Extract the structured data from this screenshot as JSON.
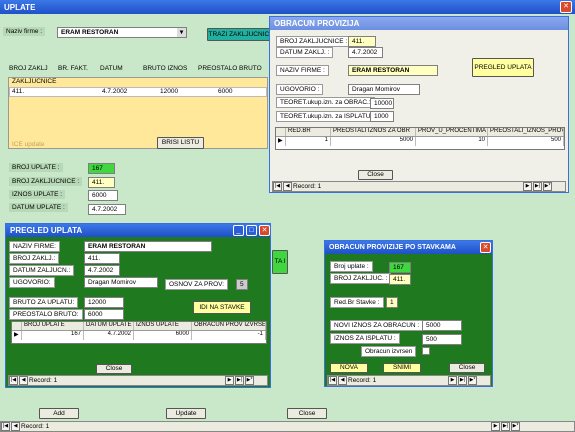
{
  "main": {
    "title": "UPLATE",
    "naziv_firme_label": "Naziv firme :",
    "naziv_firme_value": "ERAM RESTORAN",
    "trazi_btn": "TRAZI ZAKLJUCNICE",
    "columns": [
      "BROJ ZAKLJ",
      "BR. FAKT.",
      "DATUM",
      "BRUTO IZNOS",
      "PREOSTALO BRUTO"
    ],
    "zakljucnice_label": "ZAKLJUCNICE",
    "row": {
      "broj": "411.",
      "datum": "4.7.2002",
      "bruto": "12000",
      "preostalo": "6000"
    },
    "ice_label": "ICE update",
    "brisi_btn": "BRISI LISTU",
    "broj_uplate_label": "BROJ UPLATE :",
    "broj_uplate_value": "167",
    "broj_zakljucnice_label": "BROJ ZAKLJUCNICE :",
    "broj_zakljucnice_value": "411.",
    "iznos_uplate_label": "IZNOS UPLATE :",
    "iznos_uplate_value": "6000",
    "datum_uplate_label": "DATUM UPLATE :",
    "datum_uplate_value": "4.7.2002",
    "add_btn": "Add",
    "update_btn": "Update",
    "close_btn": "Close",
    "record": "Record: 1",
    "green_btn": "TA I"
  },
  "obracun": {
    "title": "OBRACUN PROVIZIJA",
    "broj_zakl_label": "BROJ ZAKLJUCNICE :",
    "broj_zakl_value": "411.",
    "datum_label": "DATUM ZAKLJ. :",
    "datum_value": "4.7.2002",
    "naziv_label": "NAZIV FIRME :",
    "naziv_value": "ERAM RESTORAN",
    "pregled_btn": "PREGLED UPLATA",
    "ugovorio_label": "UGOVORIO :",
    "ugovorio_value": "Dragan Momirov",
    "teor_obrac_label": "TEORET.ukup.izn. za OBRAC.:",
    "teor_obrac_value": "10000",
    "teor_isplatu_label": "TEORET.ukup.izn. za ISPLATU :",
    "teor_isplatu_value": "1000",
    "columns": [
      "RED.BR",
      "PREOSTALI IZNOS ZA OBR",
      "PROV_U_PROCENTIMA",
      "PREOSTALI_IZNOS_PROV"
    ],
    "row": [
      "1",
      "5000",
      "10",
      "500"
    ],
    "close_btn": "Close",
    "record": "Record: 1"
  },
  "pregled": {
    "title": "PREGLED UPLATA",
    "naziv_label": "NAZIV FIRME:",
    "naziv_value": "ERAM RESTORAN",
    "broj_zakl_label": "BROJ ZAKLJ.:",
    "broj_zakl_value": "411.",
    "datum_label": "DATUM ZALJUCN.:",
    "datum_value": "4.7.2002",
    "ugovorio_label": "UGOVORIO:",
    "ugovorio_value": "Dragan Momirov",
    "osnov_label": "OSNOV ZA PROV:",
    "osnov_value": "5",
    "bruto_label": "BRUTO ZA UPLATU:",
    "bruto_value": "12000",
    "preostalo_label": "PREOSTALO BRUTO:",
    "preostalo_value": "6000",
    "idi_btn": "IDI NA STAVKE",
    "columns": [
      "BROJ UPLATE",
      "DATUM UPLATE",
      "IZNOS UPLATE",
      "OBRACUN PROV IZVRSEN"
    ],
    "row": [
      "167",
      "4.7.2002",
      "6000",
      "-1"
    ],
    "close_btn": "Close",
    "record": "Record: 1"
  },
  "stavke": {
    "title": "OBRACUN PROVIZIJE PO STAVKAMA",
    "broj_uplate_label": "Broj uplate :",
    "broj_uplate_value": "167",
    "broj_zakl_label": "BROJ ZAKLJUC. :",
    "broj_zakl_value": "411.",
    "red_label": "Red.Br Stavke :",
    "red_value": "1",
    "novi_label": "NOVI IZNOS ZA OBRACUN :",
    "novi_value": "5000",
    "isplatu_label": "IZNOS ZA ISPLATU :",
    "isplatu_value": "500",
    "izvrsen_label": "Obracun izvrsen",
    "nova_btn": "NOVA",
    "snimi_btn": "SNIMI",
    "close_btn": "Close",
    "record": "Record: 1"
  }
}
